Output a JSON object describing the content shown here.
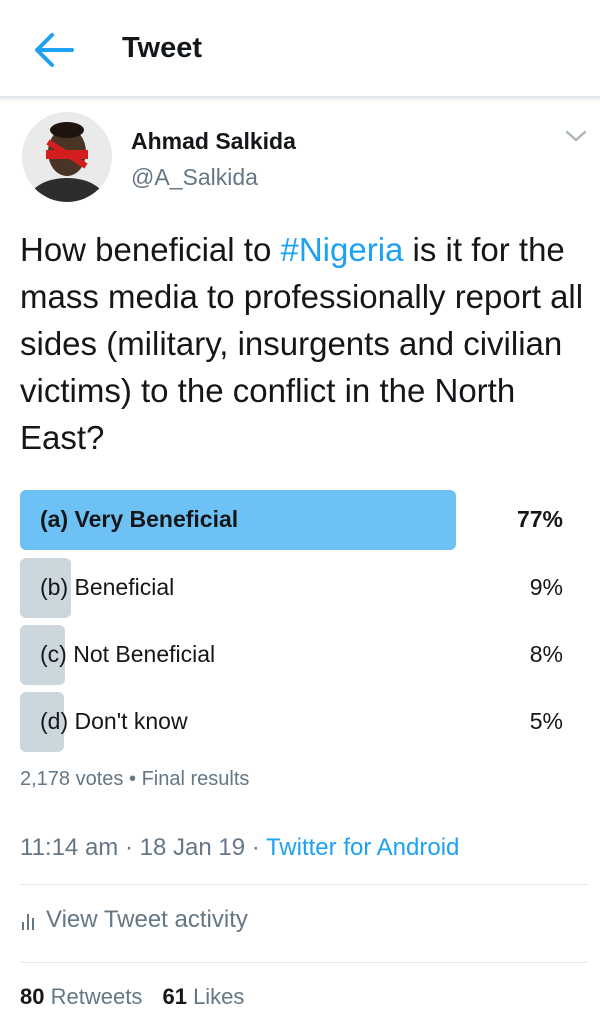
{
  "header": {
    "title": "Tweet",
    "back_icon": "arrow-left-icon"
  },
  "author": {
    "name": "Ahmad Salkida",
    "handle": "@A_Salkida",
    "menu_icon": "chevron-down-icon"
  },
  "tweet": {
    "text_before": "How beneficial to ",
    "hashtag": "#Nigeria",
    "text_after": " is it for the mass media to professionally report all sides (military, insurgents and civilian victims) to the conflict in the North East?"
  },
  "poll": {
    "options": [
      {
        "label": "(a) Very Beneficial",
        "percent_label": "77%",
        "percent": 77,
        "winner": true
      },
      {
        "label": "(b) Beneficial",
        "percent_label": "9%",
        "percent": 9,
        "winner": false
      },
      {
        "label": "(c) Not Beneficial",
        "percent_label": "8%",
        "percent": 8,
        "winner": false
      },
      {
        "label": "(d) Don't know",
        "percent_label": "5%",
        "percent": 5,
        "winner": false
      }
    ],
    "votes": "2,178 votes",
    "separator": "•",
    "status": "Final results"
  },
  "meta": {
    "time": "11:14 am",
    "dot": "·",
    "date": "18 Jan 19",
    "source": "Twitter for Android"
  },
  "activity": {
    "label": "View Tweet activity",
    "icon": "bar-chart-icon"
  },
  "stats": {
    "retweets_count": "80",
    "retweets_label": "Retweets",
    "likes_count": "61",
    "likes_label": "Likes"
  },
  "colors": {
    "accent": "#1da1f2",
    "poll_winner": "#6ec1f5",
    "poll_other": "#ccd6dd",
    "secondary_text": "#657786"
  }
}
